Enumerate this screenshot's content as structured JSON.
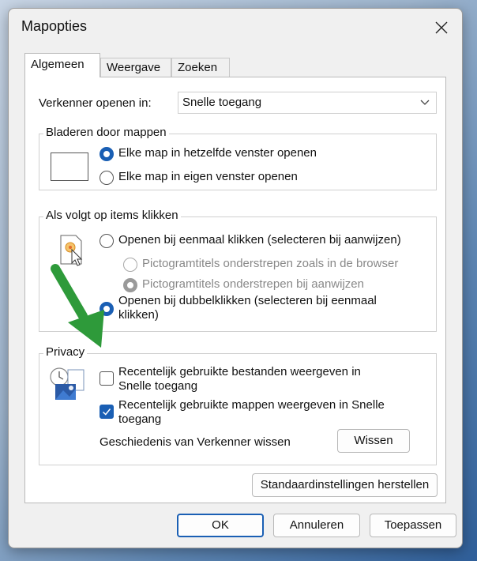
{
  "window": {
    "title": "Mapopties"
  },
  "tabs": [
    {
      "label": "Algemeen",
      "active": true
    },
    {
      "label": "Weergave",
      "active": false
    },
    {
      "label": "Zoeken",
      "active": false
    }
  ],
  "explorer": {
    "label": "Verkenner openen in:",
    "value": "Snelle toegang"
  },
  "browse": {
    "legend": "Bladeren door mappen",
    "options": [
      {
        "label": "Elke map in hetzelfde venster openen",
        "selected": true
      },
      {
        "label": "Elke map in eigen venster openen",
        "selected": false
      }
    ]
  },
  "click": {
    "legend": "Als volgt op items klikken",
    "single": "Openen bij eenmaal klikken (selecteren bij aanwijzen)",
    "sub_browser": "Pictogramtitels onderstrepen zoals in de browser",
    "sub_hover": "Pictogramtitels onderstrepen bij aanwijzen",
    "double_line1": "Openen bij dubbelklikken (selecteren bij eenmaal",
    "double_line2": "klikken)"
  },
  "privacy": {
    "legend": "Privacy",
    "recent_files_line1": "Recentelijk gebruikte bestanden weergeven in",
    "recent_files_line2": "Snelle toegang",
    "recent_files_checked": false,
    "recent_folders_line1": "Recentelijk gebruikte mappen weergeven in Snelle",
    "recent_folders_line2": "toegang",
    "recent_folders_checked": true,
    "history_label": "Geschiedenis van Verkenner wissen",
    "clear_button": "Wissen"
  },
  "restore_button": "Standaardinstellingen herstellen",
  "footer": {
    "ok": "OK",
    "cancel": "Annuleren",
    "apply": "Toepassen"
  },
  "colors": {
    "accent": "#1a5fb4",
    "annotation_arrow": "#2e9a3a"
  },
  "icons": [
    "close-icon",
    "chevron-down-icon",
    "window-preview-icon",
    "pointer-click-icon",
    "recent-files-icon",
    "checkmark-icon"
  ]
}
